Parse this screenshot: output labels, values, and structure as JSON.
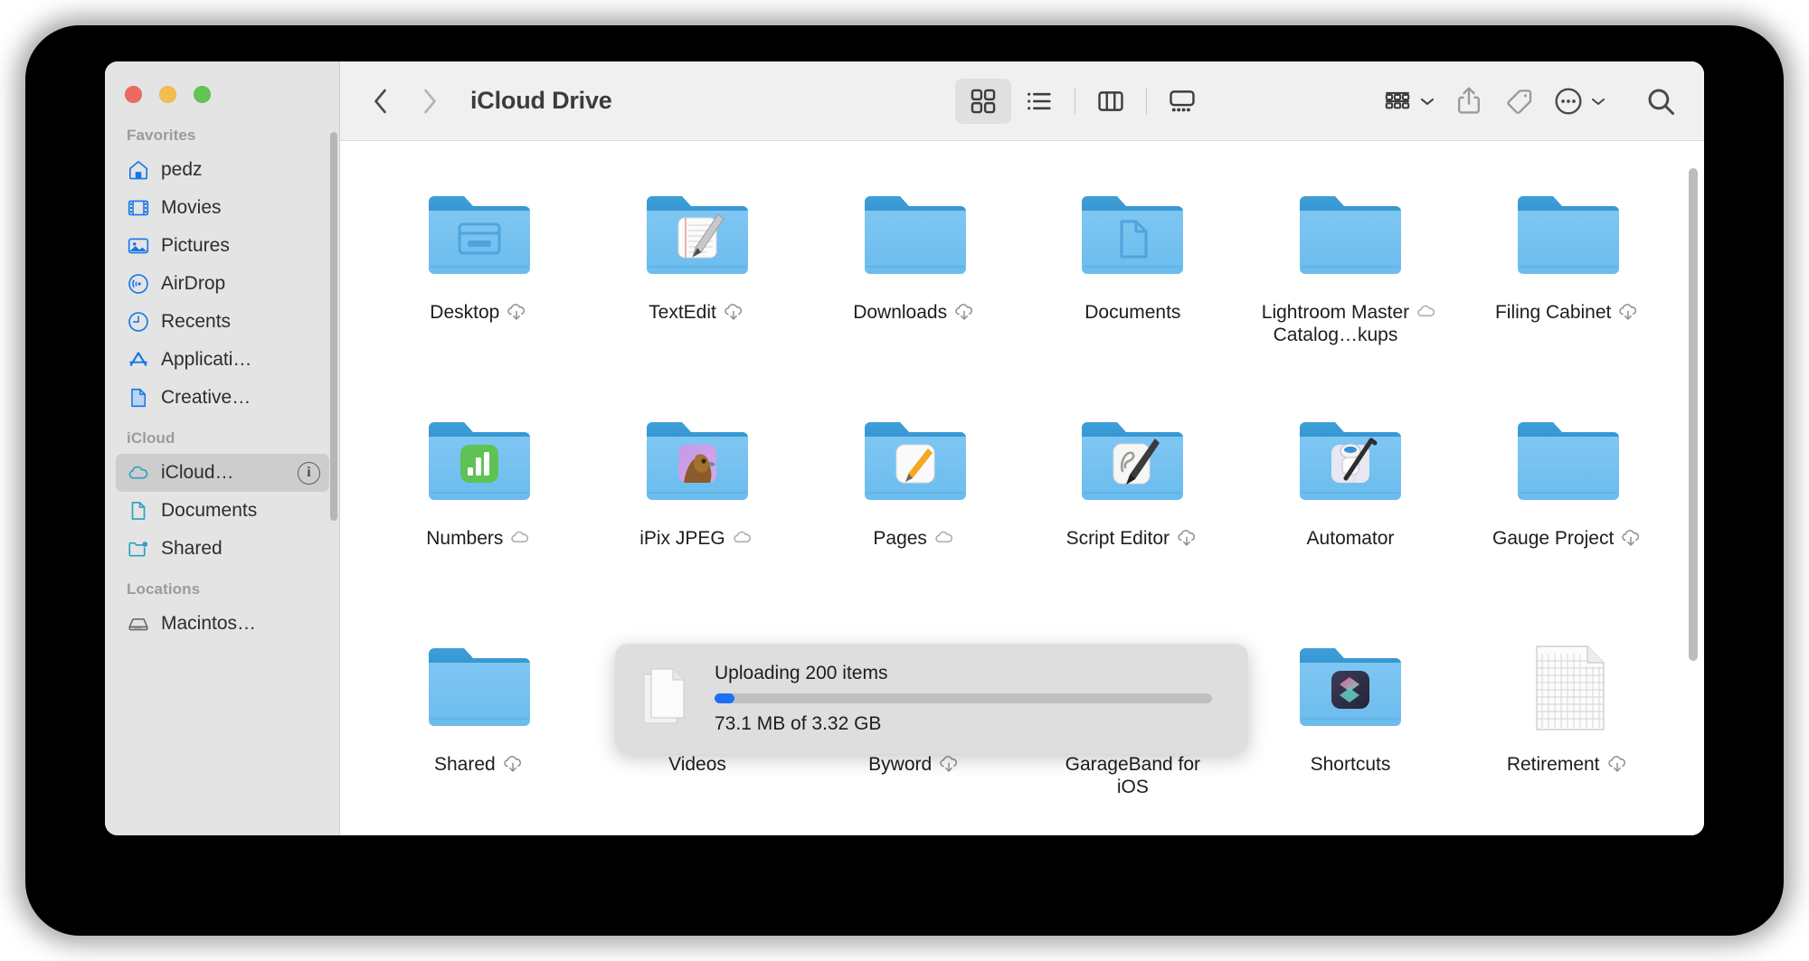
{
  "window": {
    "title": "iCloud Drive",
    "traffic_lights": [
      {
        "name": "close",
        "color": "#ec6a5f"
      },
      {
        "name": "minimize",
        "color": "#f4bd50"
      },
      {
        "name": "zoom",
        "color": "#61c454"
      }
    ]
  },
  "sidebar": {
    "sections": [
      {
        "header": "Favorites",
        "items": [
          {
            "label": "pedz",
            "icon": "home-icon",
            "selected": false
          },
          {
            "label": "Movies",
            "icon": "movies-icon",
            "selected": false
          },
          {
            "label": "Pictures",
            "icon": "pictures-icon",
            "selected": false
          },
          {
            "label": "AirDrop",
            "icon": "airdrop-icon",
            "selected": false
          },
          {
            "label": "Recents",
            "icon": "recents-clock-icon",
            "selected": false
          },
          {
            "label": "Applicati…",
            "icon": "applications-icon",
            "selected": false
          },
          {
            "label": "Creative…",
            "icon": "document-icon",
            "selected": false
          }
        ]
      },
      {
        "header": "iCloud",
        "items": [
          {
            "label": "iCloud…",
            "icon": "icloud-cloud-icon",
            "selected": true,
            "info_badge": "i"
          },
          {
            "label": "Documents",
            "icon": "icloud-document-icon",
            "selected": false
          },
          {
            "label": "Shared",
            "icon": "shared-folder-icon",
            "selected": false
          }
        ]
      },
      {
        "header": "Locations",
        "items": [
          {
            "label": "Macintos…",
            "icon": "harddisk-icon",
            "selected": false
          }
        ]
      }
    ]
  },
  "toolbar": {
    "back_label": "back-chevron",
    "forward_label": "forward-chevron",
    "view_modes": [
      {
        "name": "icon-view",
        "active": true
      },
      {
        "name": "list-view",
        "active": false
      },
      {
        "name": "column-view",
        "active": false
      },
      {
        "name": "gallery-view",
        "active": false
      }
    ],
    "actions": [
      {
        "name": "group-by",
        "has_chevron": true
      },
      {
        "name": "share",
        "has_chevron": false
      },
      {
        "name": "tags",
        "has_chevron": false
      },
      {
        "name": "more-actions",
        "has_chevron": true
      },
      {
        "name": "search",
        "has_chevron": false
      }
    ]
  },
  "files": [
    {
      "name": "Desktop",
      "icon": "folder-desktop",
      "badge": "download-cloud"
    },
    {
      "name": "TextEdit",
      "icon": "folder-textedit",
      "badge": "download-cloud"
    },
    {
      "name": "Downloads",
      "icon": "folder-plain",
      "badge": "download-cloud"
    },
    {
      "name": "Documents",
      "icon": "folder-documents",
      "badge": "none"
    },
    {
      "name": "Lightroom Master\nCatalog…kups",
      "icon": "folder-plain",
      "badge": "cloud"
    },
    {
      "name": "Filing Cabinet",
      "icon": "folder-plain",
      "badge": "download-cloud"
    },
    {
      "name": "Numbers",
      "icon": "folder-numbers",
      "badge": "cloud"
    },
    {
      "name": "iPix JPEG",
      "icon": "folder-ipix",
      "badge": "cloud"
    },
    {
      "name": "Pages",
      "icon": "folder-pages",
      "badge": "cloud"
    },
    {
      "name": "Script Editor",
      "icon": "folder-scripteditor",
      "badge": "download-cloud"
    },
    {
      "name": "Automator",
      "icon": "folder-automator",
      "badge": "none"
    },
    {
      "name": "Gauge Project",
      "icon": "folder-plain",
      "badge": "download-cloud"
    },
    {
      "name": "Shared",
      "icon": "folder-plain",
      "badge": "download-cloud"
    },
    {
      "name": "Videos",
      "icon": "folder-plain",
      "badge": "none"
    },
    {
      "name": "Byword",
      "icon": "folder-byword",
      "badge": "download-cloud"
    },
    {
      "name": "GarageBand for\niOS",
      "icon": "folder-garageband",
      "badge": "none"
    },
    {
      "name": "Shortcuts",
      "icon": "folder-shortcuts",
      "badge": "none"
    },
    {
      "name": "Retirement",
      "icon": "spreadsheet-document",
      "badge": "download-cloud"
    }
  ],
  "upload_popup": {
    "title": "Uploading 200 items",
    "detail": "73.1 MB of 3.32 GB",
    "progress_percent": 4,
    "accent_color": "#1a72f2"
  }
}
